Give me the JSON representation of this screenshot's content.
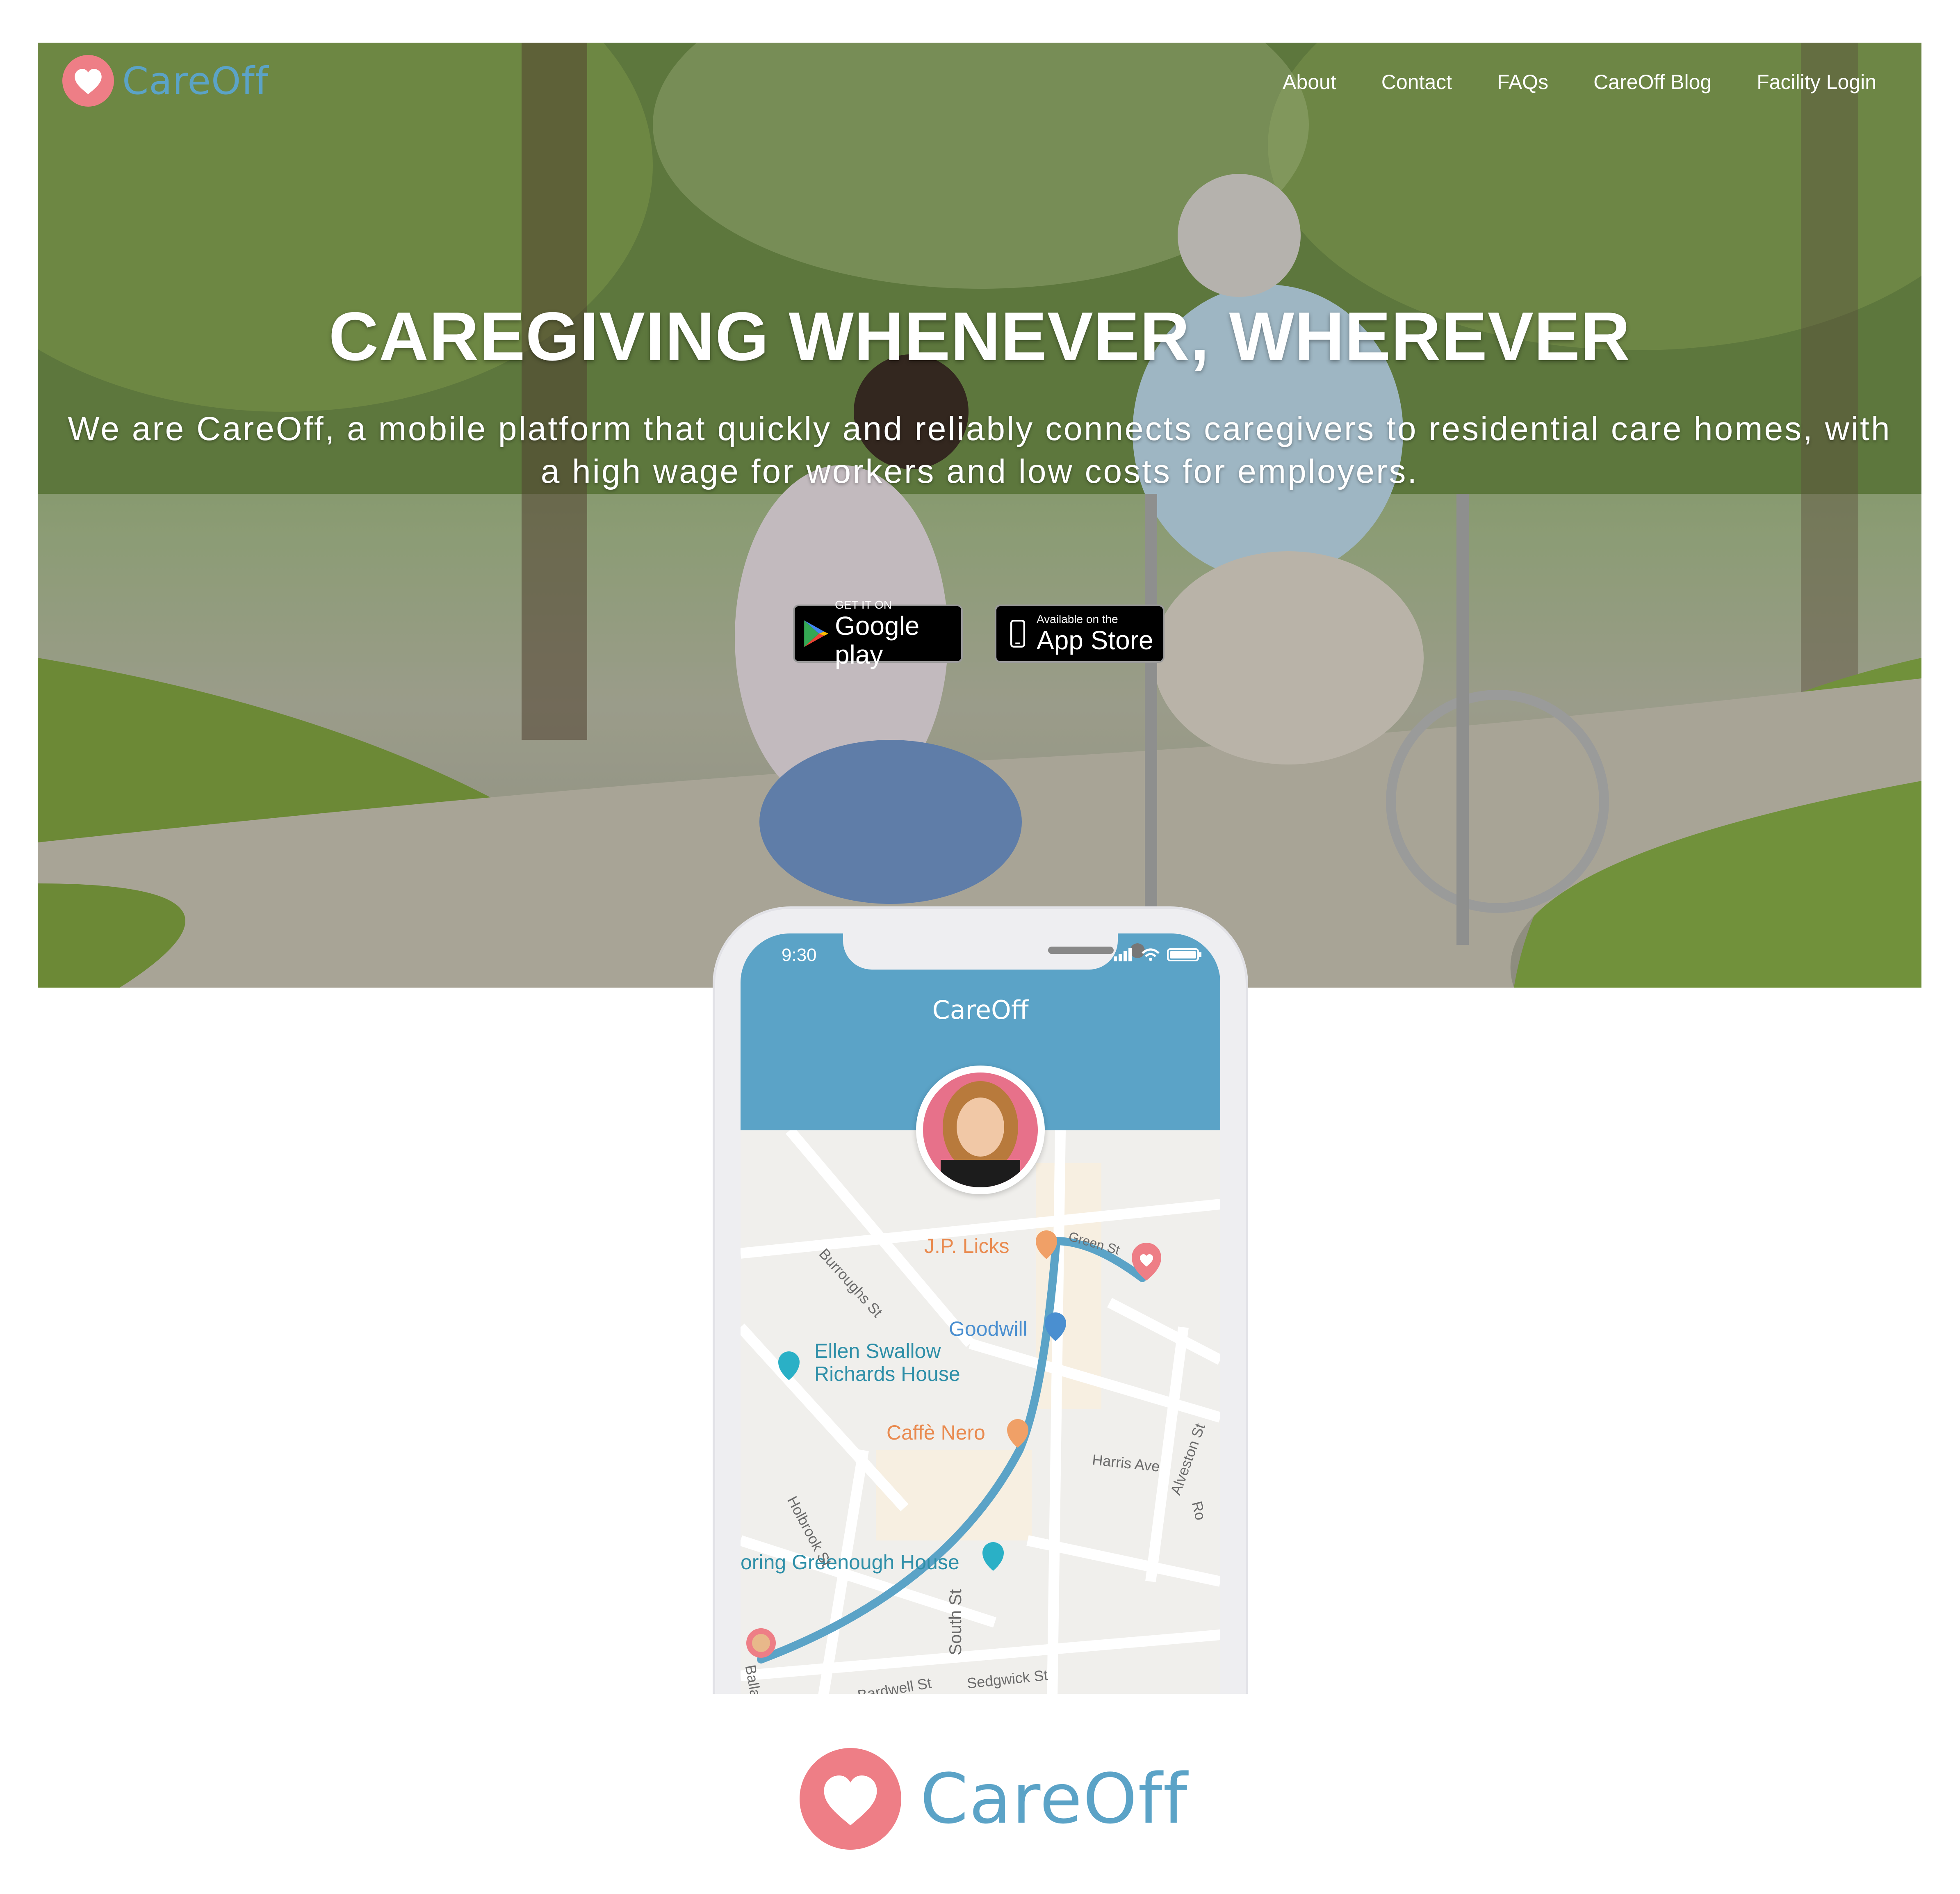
{
  "brand": {
    "name": "CareOff",
    "accent_color": "#5ba3c7",
    "heart_color": "#ee7e86"
  },
  "nav": {
    "items": [
      {
        "label": "About"
      },
      {
        "label": "Contact"
      },
      {
        "label": "FAQs"
      },
      {
        "label": "CareOff Blog"
      },
      {
        "label": "Facility Login"
      }
    ]
  },
  "hero": {
    "title": "CAREGIVING WHENEVER, WHEREVER",
    "subtitle": "We are CareOff, a mobile platform that quickly and reliably connects caregivers to residential care homes, with a high wage for workers and low costs for employers.",
    "google_play": {
      "small": "GET IT ON",
      "big": "Google play"
    },
    "app_store": {
      "small": "Available on the",
      "big": "App Store"
    }
  },
  "phone": {
    "status_time": "9:30",
    "app_title": "CareOff",
    "map": {
      "pois": [
        {
          "label": "J.P. Licks"
        },
        {
          "label": "Goodwill"
        },
        {
          "label": "Ellen Swallow\nRichards House"
        },
        {
          "label": "Caffè Nero"
        },
        {
          "label": "oring Greenough House"
        }
      ],
      "streets": [
        {
          "label": "Burroughs St"
        },
        {
          "label": "Green St"
        },
        {
          "label": "Harris Ave"
        },
        {
          "label": "Holbrook St"
        },
        {
          "label": "Alveston St"
        },
        {
          "label": "South St"
        },
        {
          "label": "Sedgwick St"
        },
        {
          "label": "Bardwell St"
        },
        {
          "label": "Ballard"
        },
        {
          "label": "Ro"
        }
      ]
    }
  },
  "footer": {
    "logo_name": "CareOff"
  }
}
